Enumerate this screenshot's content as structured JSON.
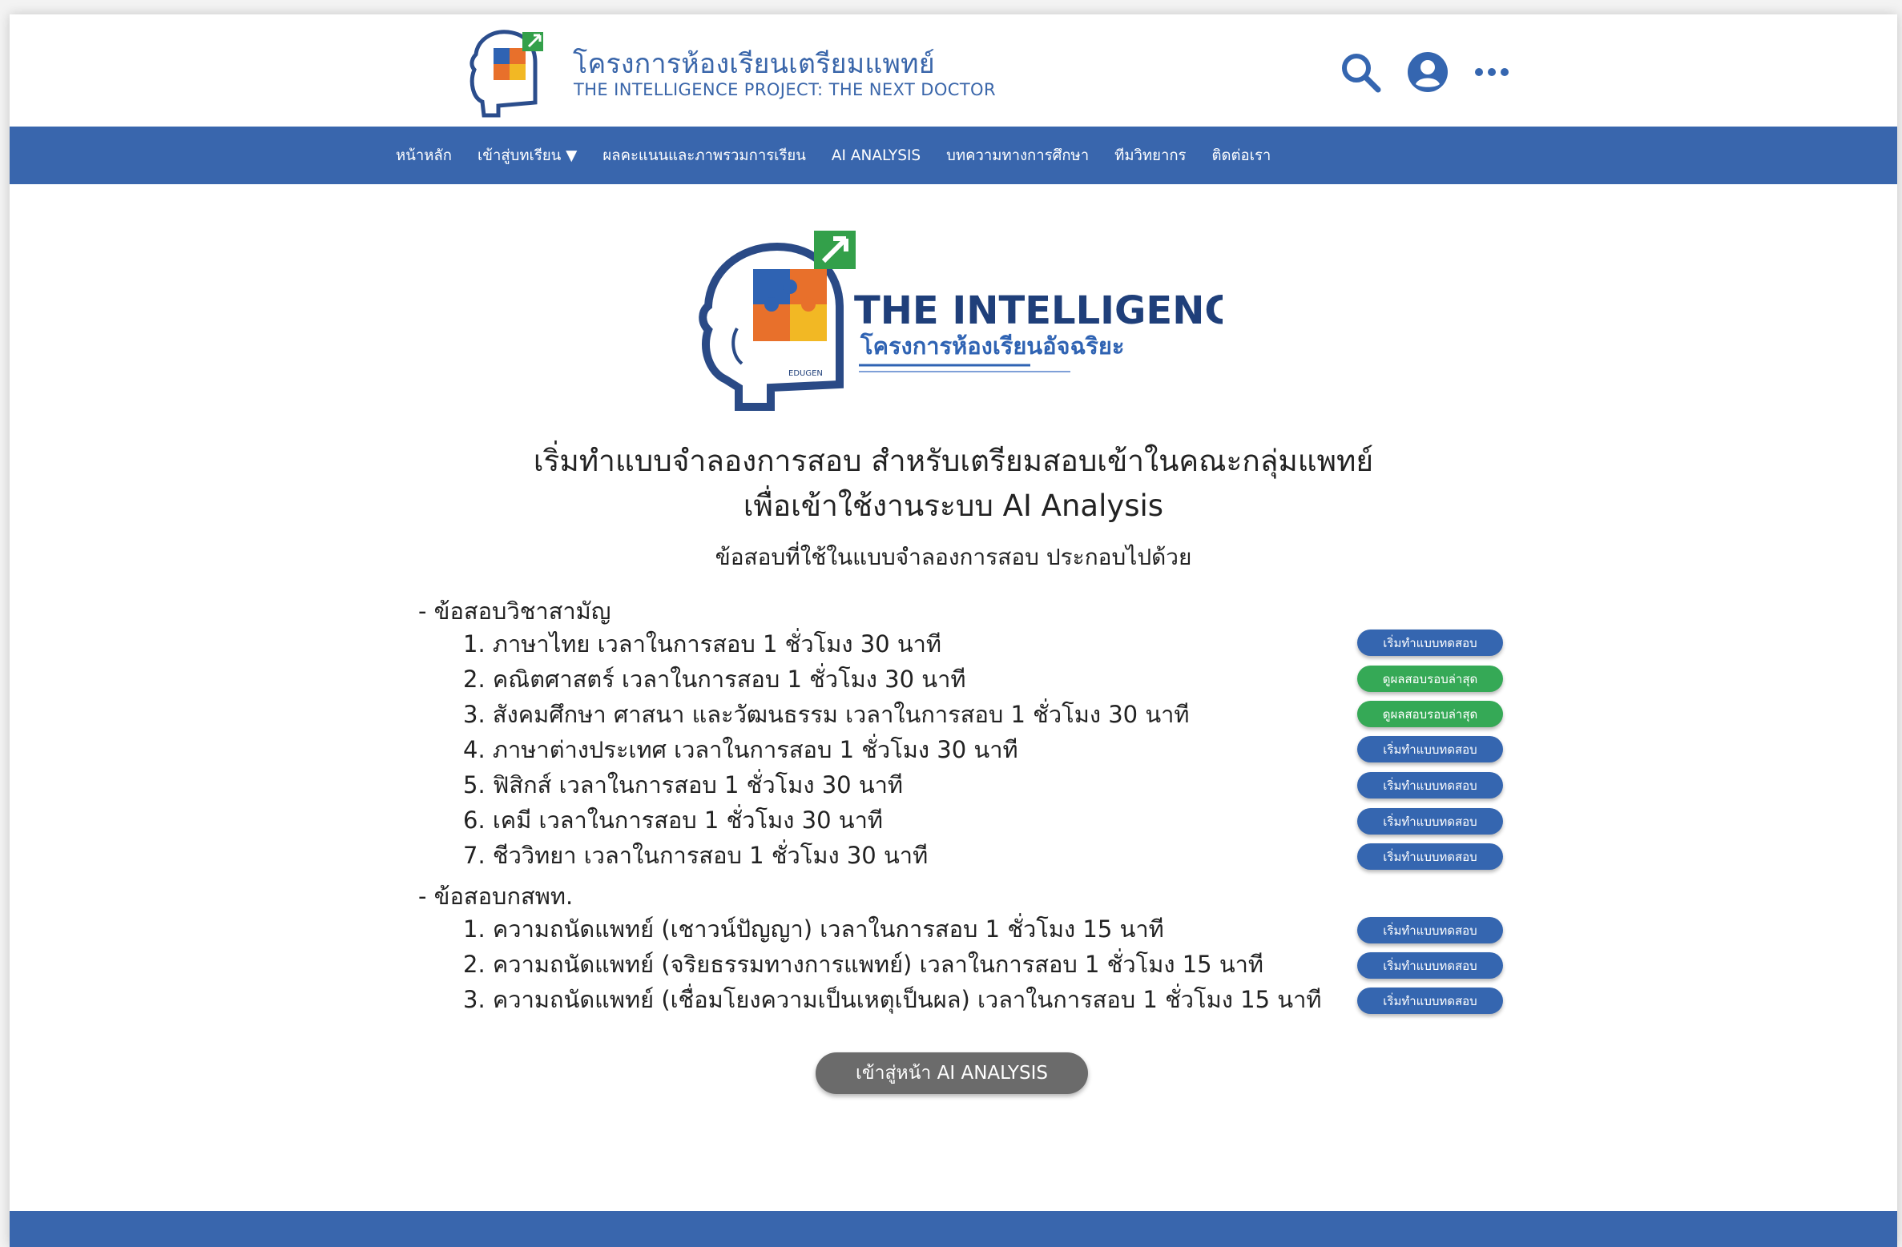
{
  "header": {
    "title": "โครงการห้องเรียนเตรียมแพทย์",
    "subtitle": "THE INTELLIGENCE PROJECT: THE NEXT DOCTOR",
    "icons": [
      "search-icon",
      "account-icon",
      "more-icon"
    ]
  },
  "nav": {
    "items": [
      {
        "label": "หน้าหลัก"
      },
      {
        "label": "เข้าสู่บทเรียน ▼"
      },
      {
        "label": "ผลคะแนนและภาพรวมการเรียน"
      },
      {
        "label": "AI ANALYSIS"
      },
      {
        "label": "บทความทางการศึกษา"
      },
      {
        "label": "ทีมวิทยากร"
      },
      {
        "label": "ติดต่อเรา"
      }
    ]
  },
  "logo": {
    "title": "THE INTELLIGENCE",
    "subtitle": "โครงการห้องเรียนอัจฉริยะ",
    "badge": "EDUGEN"
  },
  "main": {
    "heading_line1": "เริ่มทำแบบจำลองการสอบ สำหรับเตรียมสอบเข้าในคณะกลุ่มแพทย์",
    "heading_line2": "เพื่อเข้าใช้งานระบบ AI Analysis",
    "subheading": "ข้อสอบที่ใช้ในแบบจำลองการสอบ ประกอบไปด้วย",
    "sections": [
      {
        "title": "- ข้อสอบวิชาสามัญ",
        "exams": [
          {
            "label": "1. ภาษาไทย เวลาในการสอบ 1 ชั่วโมง 30 นาที",
            "button": "เริ่มทำแบบทดสอบ",
            "status": "start"
          },
          {
            "label": "2. คณิตศาสตร์ เวลาในการสอบ 1 ชั่วโมง 30 นาที",
            "button": "ดูผลสอบรอบล่าสุด",
            "status": "result"
          },
          {
            "label": "3. สังคมศึกษา ศาสนา และวัฒนธรรม เวลาในการสอบ 1 ชั่วโมง 30 นาที",
            "button": "ดูผลสอบรอบล่าสุด",
            "status": "result"
          },
          {
            "label": "4. ภาษาต่างประเทศ เวลาในการสอบ 1 ชั่วโมง 30 นาที",
            "button": "เริ่มทำแบบทดสอบ",
            "status": "start"
          },
          {
            "label": "5. ฟิสิกส์ เวลาในการสอบ 1 ชั่วโมง 30 นาที",
            "button": "เริ่มทำแบบทดสอบ",
            "status": "start"
          },
          {
            "label": "6. เคมี เวลาในการสอบ 1 ชั่วโมง 30 นาที",
            "button": "เริ่มทำแบบทดสอบ",
            "status": "start"
          },
          {
            "label": "7. ชีววิทยา เวลาในการสอบ 1 ชั่วโมง 30 นาที",
            "button": "เริ่มทำแบบทดสอบ",
            "status": "start"
          }
        ]
      },
      {
        "title": "- ข้อสอบกสพท.",
        "exams": [
          {
            "label": "1. ความถนัดแพทย์ (เชาวน์ปัญญา) เวลาในการสอบ 1 ชั่วโมง 15 นาที",
            "button": "เริ่มทำแบบทดสอบ",
            "status": "start"
          },
          {
            "label": "2. ความถนัดแพทย์ (จริยธรรมทางการแพทย์) เวลาในการสอบ 1 ชั่วโมง 15 นาที",
            "button": "เริ่มทำแบบทดสอบ",
            "status": "start"
          },
          {
            "label": "3. ความถนัดแพทย์ (เชื่อมโยงความเป็นเหตุเป็นผล) เวลาในการสอบ 1 ชั่วโมง 15 นาที",
            "button": "เริ่มทำแบบทดสอบ",
            "status": "start"
          }
        ]
      }
    ],
    "ai_button": "เข้าสู่หน้า AI ANALYSIS"
  },
  "colors": {
    "brand_blue": "#3966ad",
    "start_button": "#3566b0",
    "result_button": "#35a956",
    "ai_button": "#6b6b6b"
  }
}
